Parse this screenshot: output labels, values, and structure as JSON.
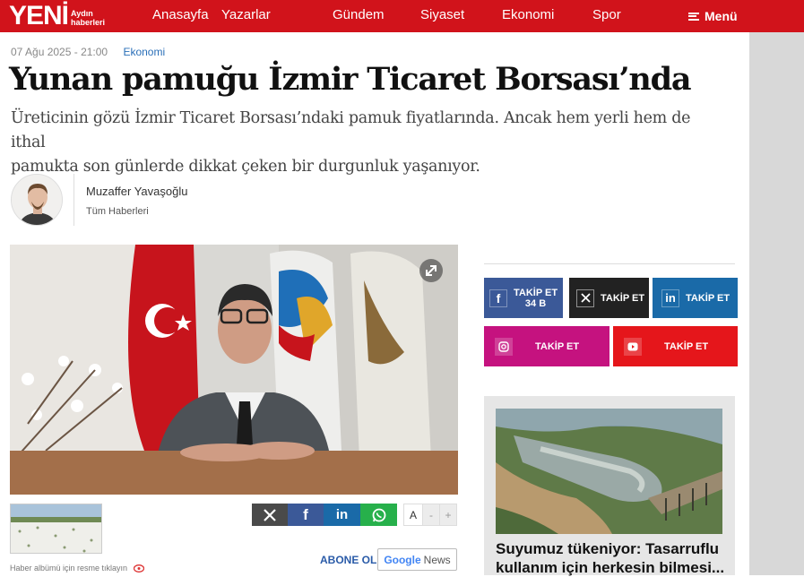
{
  "header": {
    "logo_word": "YENİ",
    "logo_sub_1": "Aydın",
    "logo_sub_2": "haberleri",
    "nav": [
      "Anasayfa",
      "Yazarlar",
      "Gündem",
      "Siyaset",
      "Ekonomi",
      "Spor"
    ],
    "menu_label": "Menü"
  },
  "article": {
    "date": "07 Ağu 2025 - 21:00",
    "category": "Ekonomi",
    "title": "Yunan pamuğu İzmir Ticaret Borsası’nda",
    "summary_line1": "Üreticinin gözü İzmir Ticaret Borsası’ndaki pamuk fiyatlarında. Ancak hem yerli hem de ithal",
    "summary_line2": "pamukta son günlerde dikkat çeken bir durgunluk yaşanıyor.",
    "author_name": "Muzaffer Yavaşoğlu",
    "author_link": "Tüm Haberleri",
    "album_note": "Haber albümü için resme tıklayın"
  },
  "share": {
    "font_a": "A",
    "font_minus": "-",
    "font_plus": "+",
    "abone": "ABONE OL",
    "gnews_google": "Google",
    "gnews_news": "News"
  },
  "social": {
    "facebook_label": "TAKİP ET",
    "facebook_count": "34 B",
    "x_label": "TAKİP ET",
    "linkedin_label": "TAKİP ET",
    "instagram_label": "TAKİP ET",
    "youtube_label": "TAKİP ET"
  },
  "sidebar_card": {
    "title_line1": "Suyumuz tükeniyor: Tasarruflu",
    "title_line2": "kullanım için herkesin bilmesi..."
  },
  "colors": {
    "brand_red": "#d1131b",
    "facebook": "#3b5998",
    "x": "#222222",
    "linkedin": "#1a6aa8",
    "instagram": "#c5127f",
    "youtube": "#e5161b",
    "whatsapp": "#27b04b"
  }
}
